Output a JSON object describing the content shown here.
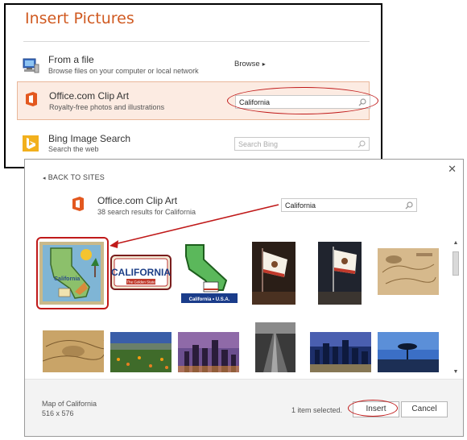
{
  "insert_pictures": {
    "title": "Insert Pictures",
    "from_file": {
      "title": "From a file",
      "subtitle": "Browse files on your computer or local network",
      "action": "Browse"
    },
    "clipart": {
      "title": "Office.com Clip Art",
      "subtitle": "Royalty-free photos and illustrations",
      "search_value": "California"
    },
    "bing": {
      "title": "Bing Image Search",
      "subtitle": "Search the web",
      "placeholder": "Search Bing"
    }
  },
  "results_dialog": {
    "back_label": "BACK TO SITES",
    "close_symbol": "✕",
    "source_title": "Office.com Clip Art",
    "result_summary": "38 search results for California",
    "search_value": "California",
    "thumbnails": [
      {
        "name": "map-of-california",
        "selected": true
      },
      {
        "name": "california-license-plate",
        "text": "CALIFORNIA",
        "subtext": "The Golden State"
      },
      {
        "name": "california-usa-map",
        "text": "California • U.S.A."
      },
      {
        "name": "california-flag-1"
      },
      {
        "name": "california-flag-2"
      },
      {
        "name": "old-map-1"
      },
      {
        "name": "old-map-2"
      },
      {
        "name": "poppy-field"
      },
      {
        "name": "city-skyline-dusk"
      },
      {
        "name": "sunbeams-bw"
      },
      {
        "name": "city-lights-night"
      },
      {
        "name": "lone-tree-sunset"
      }
    ],
    "footer": {
      "caption_title": "Map of California",
      "caption_size": "516 x 576",
      "selection_status": "1 item selected.",
      "insert_label": "Insert",
      "cancel_label": "Cancel"
    }
  },
  "colors": {
    "accent": "#d05a21",
    "annotation": "#c01a1a",
    "office_orange": "#e3581f",
    "bing_yellow": "#f2b01d"
  }
}
